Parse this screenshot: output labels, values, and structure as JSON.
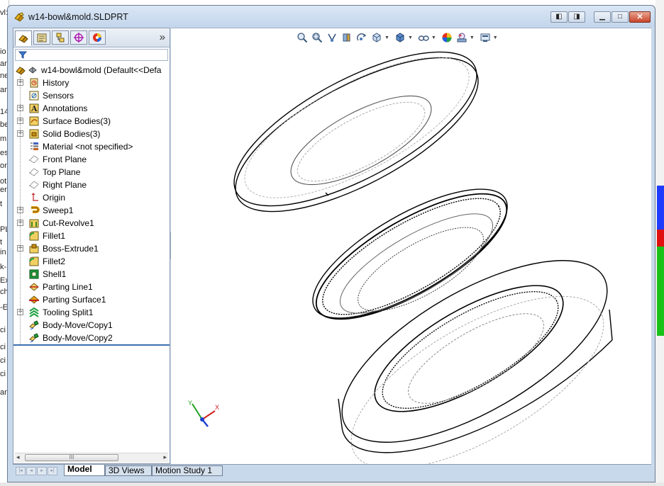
{
  "window": {
    "title": "w14-bowl&mold.SLDPRT",
    "buttons": [
      "restore-left",
      "restore-right",
      "minimize",
      "maximize",
      "close"
    ]
  },
  "background_app": {
    "left_fragments": [
      "vl:",
      "io",
      "an",
      "ne",
      "an",
      "14",
      "be",
      "m",
      "es",
      "or",
      "ot",
      "eri",
      "t",
      "PL",
      "t",
      "in",
      "k-",
      "Ex",
      "ch",
      "-E",
      "ci",
      "ci",
      "ci",
      "ci",
      "an"
    ]
  },
  "feature_manager": {
    "tabs": [
      "featuremanager-tab",
      "propertymanager-tab",
      "configurationmanager-tab",
      "dimxpert-tab",
      "display-manager-tab"
    ],
    "more_label": "»",
    "root": {
      "label": "w14-bowl&mold  (Default<<Defa"
    },
    "items": [
      {
        "label": "History",
        "icon": "history-icon",
        "expandable": true
      },
      {
        "label": "Sensors",
        "icon": "sensors-icon",
        "expandable": false
      },
      {
        "label": "Annotations",
        "icon": "annotations-icon",
        "expandable": true
      },
      {
        "label": "Surface Bodies(3)",
        "icon": "surface-bodies-icon",
        "expandable": true
      },
      {
        "label": "Solid Bodies(3)",
        "icon": "solid-bodies-icon",
        "expandable": true
      },
      {
        "label": "Material <not specified>",
        "icon": "material-icon",
        "expandable": false
      },
      {
        "label": "Front Plane",
        "icon": "plane-icon",
        "expandable": false
      },
      {
        "label": "Top Plane",
        "icon": "plane-icon",
        "expandable": false
      },
      {
        "label": "Right Plane",
        "icon": "plane-icon",
        "expandable": false
      },
      {
        "label": "Origin",
        "icon": "origin-icon",
        "expandable": false
      },
      {
        "label": "Sweep1",
        "icon": "sweep-icon",
        "expandable": true
      },
      {
        "label": "Cut-Revolve1",
        "icon": "cut-revolve-icon",
        "expandable": true
      },
      {
        "label": "Fillet1",
        "icon": "fillet-icon",
        "expandable": false
      },
      {
        "label": "Boss-Extrude1",
        "icon": "boss-extrude-icon",
        "expandable": true
      },
      {
        "label": "Fillet2",
        "icon": "fillet-icon",
        "expandable": false
      },
      {
        "label": "Shell1",
        "icon": "shell-icon",
        "expandable": false
      },
      {
        "label": "Parting Line1",
        "icon": "parting-line-icon",
        "expandable": false
      },
      {
        "label": "Parting Surface1",
        "icon": "parting-surface-icon",
        "expandable": false
      },
      {
        "label": "Tooling Split1",
        "icon": "tooling-split-icon",
        "expandable": true
      },
      {
        "label": "Body-Move/Copy1",
        "icon": "body-move-icon",
        "expandable": false
      },
      {
        "label": "Body-Move/Copy2",
        "icon": "body-move-icon",
        "expandable": false
      }
    ],
    "scroll_grip": "III"
  },
  "heads_up_toolbar": {
    "icons": [
      "zoom-to-fit-icon",
      "zoom-to-area-icon",
      "previous-view-icon",
      "section-view-icon",
      "dynamic-annotation-icon",
      "view-orientation-icon",
      "display-style-icon",
      "hide-show-items-icon",
      "edit-appearance-icon",
      "apply-scene-icon",
      "view-settings-icon"
    ]
  },
  "bottom_tabs": {
    "tabs": [
      {
        "label": "Model",
        "active": true
      },
      {
        "label": "3D Views",
        "active": false
      },
      {
        "label": "Motion Study 1",
        "active": false
      }
    ]
  },
  "triad": {
    "x_label": "X",
    "y_label": "Y"
  },
  "colors": {
    "title_gradient_top": "#d9e6f5",
    "panel_selection_line": "#3d6fb0",
    "close_button": "#c9452a",
    "triad_x": "#d02020",
    "triad_y": "#20a020",
    "triad_z": "#2040d0"
  }
}
